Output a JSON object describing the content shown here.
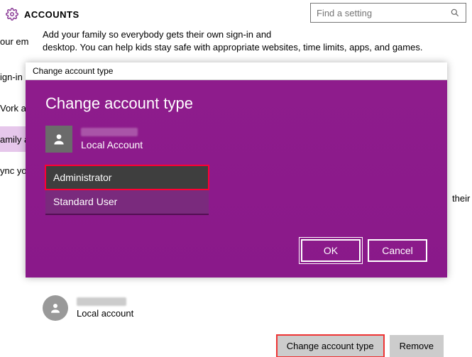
{
  "header": {
    "title": "ACCOUNTS",
    "search_placeholder": "Find a setting"
  },
  "sidebar": {
    "items": [
      {
        "label": "our email and accounts"
      },
      {
        "label": "ign-in"
      },
      {
        "label": "Vork a"
      },
      {
        "label": "amily a"
      },
      {
        "label": "ync yo"
      }
    ]
  },
  "main": {
    "intro_cut": "Add your family so everybody gets their own sign-in and",
    "intro_rest": "desktop. You can help kids stay safe with appropriate websites, time limits, apps, and games.",
    "right_overflow": "their"
  },
  "user_row": {
    "sub": "Local account"
  },
  "actions": {
    "change": "Change account type",
    "remove": "Remove"
  },
  "dialog": {
    "titlebar": "Change account type",
    "heading": "Change account type",
    "local": "Local Account",
    "options": {
      "admin": "Administrator",
      "standard": "Standard User"
    },
    "ok": "OK",
    "cancel": "Cancel"
  }
}
